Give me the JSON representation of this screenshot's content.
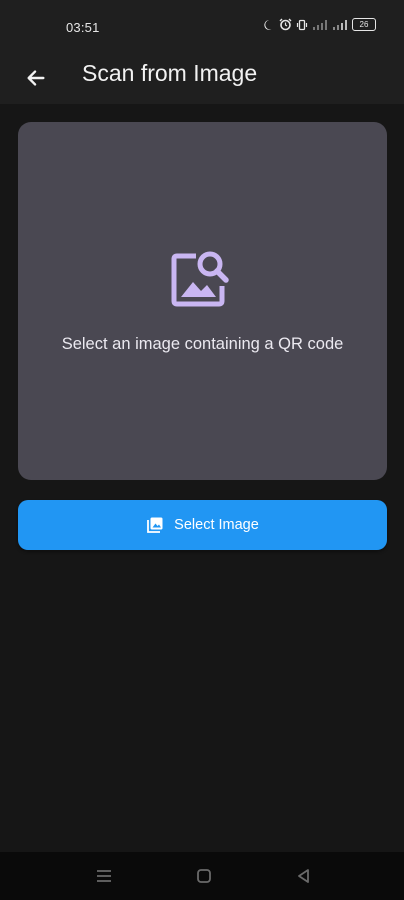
{
  "status_bar": {
    "time": "03:51",
    "battery": "26",
    "icons": [
      "moon-icon",
      "alarm-icon",
      "vibrate-icon",
      "signal-icon",
      "signal-icon",
      "battery-icon"
    ]
  },
  "app_bar": {
    "title": "Scan from Image",
    "back_icon": "arrow-left-icon"
  },
  "preview": {
    "icon": "image-search-icon",
    "icon_color": "#c9b6f2",
    "message": "Select an image containing a QR code",
    "background": "#4a4852"
  },
  "select_button": {
    "label": "Select Image",
    "icon": "photo-library-icon",
    "color": "#2196f3"
  },
  "nav_bar": {
    "items": [
      "menu-icon",
      "home-square-icon",
      "back-triangle-icon"
    ]
  }
}
